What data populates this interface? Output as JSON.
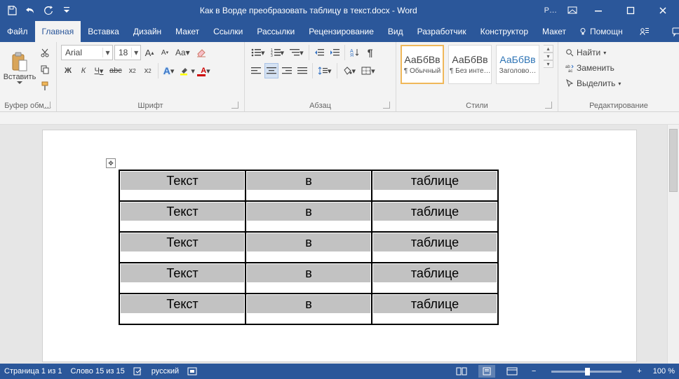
{
  "title": "Как в Ворде преобразовать таблицу в текст.docx - Word",
  "user": "P…",
  "tabs": {
    "file": "Файл",
    "home": "Главная",
    "insert": "Вставка",
    "design": "Дизайн",
    "layout": "Макет",
    "references": "Ссылки",
    "mailings": "Рассылки",
    "review": "Рецензирование",
    "view": "Вид",
    "developer": "Разработчик",
    "table_design": "Конструктор",
    "table_layout": "Макет"
  },
  "tell_me": "Помощн",
  "ribbon": {
    "clipboard": {
      "paste": "Вставить",
      "label": "Буфер обм…"
    },
    "font": {
      "name": "Arial",
      "size": "18",
      "label": "Шрифт",
      "bold": "Ж",
      "italic": "К",
      "underline": "Ч",
      "strike": "abc"
    },
    "paragraph": {
      "label": "Абзац"
    },
    "styles": {
      "label": "Стили",
      "preview": "АаБбВв",
      "preview_heading": "АаБбВв",
      "items": [
        {
          "label": "¶ Обычный"
        },
        {
          "label": "¶ Без инте…"
        },
        {
          "label": "Заголово…"
        }
      ]
    },
    "editing": {
      "label": "Редактирование",
      "find": "Найти",
      "replace": "Заменить",
      "select": "Выделить"
    }
  },
  "document": {
    "rows": [
      [
        "Текст",
        "в",
        "таблице"
      ],
      [
        "Текст",
        "в",
        "таблице"
      ],
      [
        "Текст",
        "в",
        "таблице"
      ],
      [
        "Текст",
        "в",
        "таблице"
      ],
      [
        "Текст",
        "в",
        "таблице"
      ]
    ]
  },
  "status": {
    "page": "Страница 1 из 1",
    "words": "Слово 15 из 15",
    "lang": "русский",
    "zoom": "100 %"
  }
}
